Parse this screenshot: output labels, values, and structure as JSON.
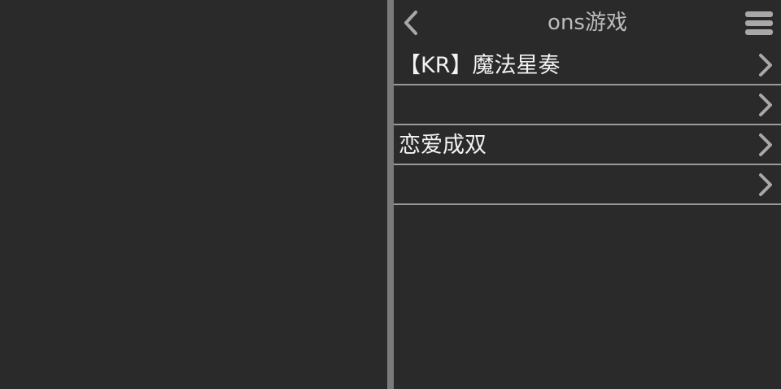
{
  "header": {
    "title": "ons游戏",
    "back_icon": "chevron-left-icon",
    "menu_icon": "hamburger-menu-icon"
  },
  "games": [
    {
      "label": "【KR】魔法星奏"
    },
    {
      "label": ""
    },
    {
      "label": "恋爱成双"
    },
    {
      "label": ""
    }
  ],
  "colors": {
    "background": "#2a2a2a",
    "divider": "#7a7a7a",
    "title_text": "#bcbcbc",
    "item_text": "#f2f2f2",
    "separator": "#9a9a9a",
    "icon": "#a8a8a8"
  }
}
